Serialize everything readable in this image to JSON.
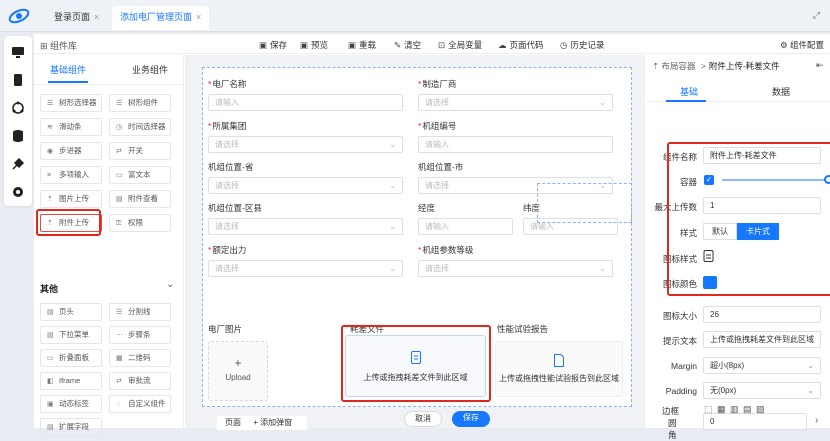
{
  "tabs": [
    {
      "label": "登录页面",
      "close": "×"
    },
    {
      "label": "添加电厂管理页面",
      "close": "×"
    }
  ],
  "expand_icon": "⤢",
  "toolbar": {
    "library": "组件库",
    "actions": [
      "保存",
      "预览",
      "重载",
      "清空",
      "全局变量",
      "页面代码",
      "历史记录"
    ],
    "config": "组件配置"
  },
  "left_panel": {
    "tabs": [
      "基础组件",
      "业务组件"
    ],
    "basic": [
      [
        "树形选择器",
        "树形组件"
      ],
      [
        "滑动条",
        "时间选择器"
      ],
      [
        "步进器",
        "开关"
      ],
      [
        "多项输入",
        "富文本"
      ],
      [
        "图片上传",
        "附件查看"
      ],
      [
        "附件上传",
        "权限"
      ]
    ],
    "other_title": "其他",
    "other_chevron": "⌄",
    "other": [
      [
        "页头",
        "分割线"
      ],
      [
        "下拉菜单",
        "步骤条"
      ],
      [
        "折叠面板",
        "二维码"
      ],
      [
        "Iframe",
        "审批流"
      ],
      [
        "动态标签",
        "自定义组件"
      ],
      [
        "扩展字段"
      ]
    ]
  },
  "form": {
    "fields": [
      {
        "label": "电厂名称",
        "required": true,
        "placeholder": "请输入",
        "select": false
      },
      {
        "label": "制造厂商",
        "required": true,
        "placeholder": "请选择",
        "select": true
      },
      {
        "label": "所属集团",
        "required": true,
        "placeholder": "请选择",
        "select": true
      },
      {
        "label": "机组编号",
        "required": true,
        "placeholder": "请输入",
        "select": false
      },
      {
        "label": "机组位置-省",
        "required": false,
        "placeholder": "请选择",
        "select": true
      },
      {
        "label": "机组位置-市",
        "required": false,
        "placeholder": "请选择",
        "select": true
      },
      {
        "label": "机组位置-区县",
        "required": false,
        "placeholder": "请选择",
        "select": true
      },
      {
        "label": "经度",
        "required": false,
        "placeholder": "请输入",
        "select": false
      },
      {
        "label": "纬度",
        "required": false,
        "placeholder": "请输入",
        "select": false
      },
      {
        "label": "额定出力",
        "required": true,
        "placeholder": "请选择",
        "select": true
      },
      {
        "label": "机组参数等级",
        "required": true,
        "placeholder": "请选择",
        "select": true
      }
    ],
    "plant_photo": "电厂图片",
    "upload_plus": "+",
    "upload_text": "Upload",
    "loss_file_label": "耗差文件",
    "loss_file_text": "上传或拖拽耗差文件到此区域",
    "perf_report_label": "性能试验报告",
    "perf_report_text": "上传或拖拽性能试验报告到此区域",
    "cancel": "取消",
    "save": "保存"
  },
  "page_bar": {
    "page": "页面",
    "add_dialog": "+ 添加弹窗"
  },
  "right_panel": {
    "breadcrumb_root": "布局容器",
    "breadcrumb_sep": ">",
    "breadcrumb_current": "附件上传-耗差文件",
    "tabs": [
      "基础",
      "数据"
    ],
    "component_name_label": "组件名称",
    "component_name_value": "附件上传-耗差文件",
    "container_label": "容器",
    "max_upload_label": "最大上传数",
    "max_upload_value": "1",
    "style_label": "样式",
    "style_options": [
      "默认",
      "卡片式"
    ],
    "icon_style_label": "图标样式",
    "icon_color_label": "图标颜色",
    "icon_color": "#1677ff",
    "icon_size_label": "图标大小",
    "icon_size_value": "26",
    "hint_label": "提示文本",
    "hint_value": "上传或拖拽耗差文件到此区域",
    "margin_label": "Margin",
    "margin_value": "超小(8px)",
    "padding_label": "Padding",
    "padding_value": "无(0px)",
    "radius_label": "圆角",
    "radius_value": "0",
    "border_label": "边框"
  },
  "colors": {
    "primary": "#1677ff",
    "highlight": "#e0281c"
  }
}
